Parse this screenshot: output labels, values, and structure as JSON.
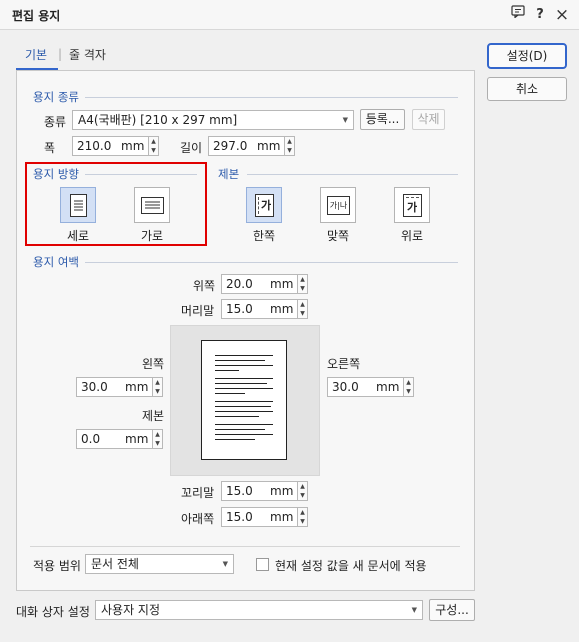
{
  "window": {
    "title": "편집 용지",
    "icons": {
      "chat": "chat-icon",
      "help": "?",
      "close": "×"
    }
  },
  "tabs": [
    {
      "label": "기본"
    },
    {
      "label": "줄 격자"
    }
  ],
  "buttons": {
    "ok": "설정(D)",
    "cancel": "취소"
  },
  "paper_type": {
    "title": "용지 종류",
    "type_label": "종류",
    "type_value": "A4(국배판) [210 x 297 mm]",
    "register_label": "등록...",
    "delete_label": "삭제",
    "width_label": "폭",
    "width_value": "210.0",
    "height_label": "길이",
    "height_value": "297.0",
    "unit": "mm"
  },
  "orientation": {
    "title": "용지 방향",
    "portrait": "세로",
    "landscape": "가로",
    "selected": "portrait"
  },
  "binding": {
    "title": "제본",
    "one_side": "한쪽",
    "facing": "맞쪽",
    "top": "위로",
    "glyph": "가",
    "glyph_facing": "가|나",
    "selected": "one_side"
  },
  "margins": {
    "title": "용지 여백",
    "unit": "mm",
    "top_label": "위쪽",
    "top_value": "20.0",
    "header_label": "머리말",
    "header_value": "15.0",
    "left_label": "왼쪽",
    "left_value": "30.0",
    "right_label": "오른쪽",
    "right_value": "30.0",
    "gutter_label": "제본",
    "gutter_value": "0.0",
    "footer_label": "꼬리말",
    "footer_value": "15.0",
    "bottom_label": "아래쪽",
    "bottom_value": "15.0"
  },
  "apply": {
    "scope_label": "적용 범위",
    "scope_value": "문서 전체",
    "checkbox_label": "현재 설정 값을 새 문서에 적용",
    "checkbox_checked": false
  },
  "dialog_settings": {
    "label": "대화 상자 설정",
    "value": "사용자 지정",
    "configure_label": "구성..."
  }
}
